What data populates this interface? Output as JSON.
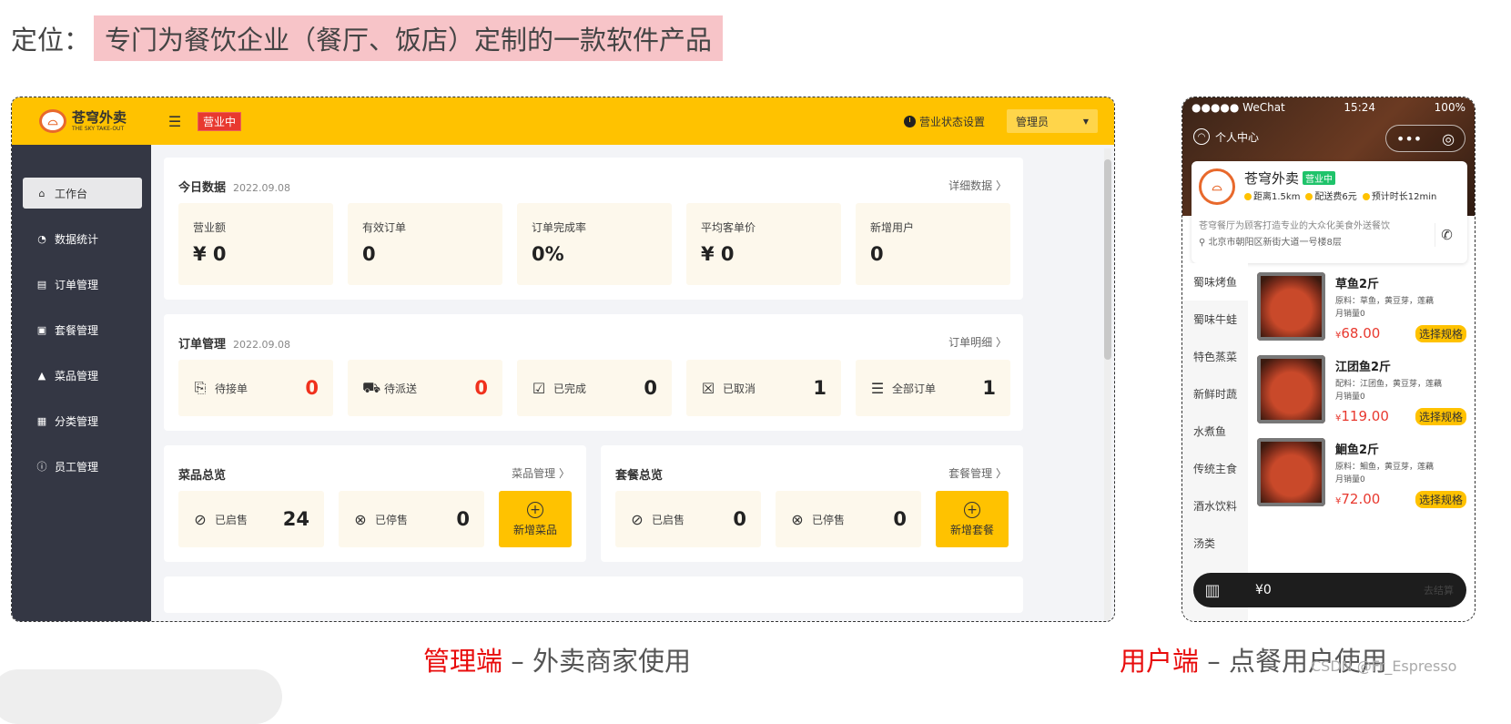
{
  "headline": {
    "prefix": "定位：",
    "highlight": "专门为餐饮企业（餐厅、饭店）定制的一款软件产品"
  },
  "admin": {
    "logo": {
      "name": "苍穹外卖",
      "sub": "THE SKY TAKE-OUT"
    },
    "status_badge": "营业中",
    "status_setting": "营业状态设置",
    "user_select": "管理员",
    "sidebar": [
      {
        "label": "工作台",
        "icon": "home-icon",
        "glyph": "⌂"
      },
      {
        "label": "数据统计",
        "icon": "chart-icon",
        "glyph": "◔"
      },
      {
        "label": "订单管理",
        "icon": "clipboard-icon",
        "glyph": "▤"
      },
      {
        "label": "套餐管理",
        "icon": "gift-icon",
        "glyph": "▣"
      },
      {
        "label": "菜品管理",
        "icon": "dish-icon",
        "glyph": "▲"
      },
      {
        "label": "分类管理",
        "icon": "grid-icon",
        "glyph": "▦"
      },
      {
        "label": "员工管理",
        "icon": "info-icon",
        "glyph": "ⓘ"
      }
    ],
    "today": {
      "title": "今日数据",
      "date": "2022.09.08",
      "link": "详细数据 〉",
      "stats": [
        {
          "label": "营业额",
          "value": "¥ 0"
        },
        {
          "label": "有效订单",
          "value": "0"
        },
        {
          "label": "订单完成率",
          "value": "0%"
        },
        {
          "label": "平均客单价",
          "value": "¥ 0"
        },
        {
          "label": "新增用户",
          "value": "0"
        }
      ]
    },
    "orders": {
      "title": "订单管理",
      "date": "2022.09.08",
      "link": "订单明细 〉",
      "stats": [
        {
          "label": "待接单",
          "value": "0",
          "highlight": true,
          "icon": "pending-order-icon",
          "glyph": "⎘"
        },
        {
          "label": "待派送",
          "value": "0",
          "highlight": true,
          "icon": "delivery-icon",
          "glyph": "⛟"
        },
        {
          "label": "已完成",
          "value": "0",
          "highlight": false,
          "icon": "completed-icon",
          "glyph": "☑"
        },
        {
          "label": "已取消",
          "value": "1",
          "highlight": false,
          "icon": "cancelled-icon",
          "glyph": "☒"
        },
        {
          "label": "全部订单",
          "value": "1",
          "highlight": false,
          "icon": "all-orders-icon",
          "glyph": "☰"
        }
      ]
    },
    "dishes": {
      "title": "菜品总览",
      "link": "菜品管理 〉",
      "on_label": "已启售",
      "on_value": "24",
      "off_label": "已停售",
      "off_value": "0",
      "add_label": "新增菜品"
    },
    "setmeals": {
      "title": "套餐总览",
      "link": "套餐管理 〉",
      "on_label": "已启售",
      "on_value": "0",
      "off_label": "已停售",
      "off_value": "0",
      "add_label": "新增套餐"
    }
  },
  "phone": {
    "carrier": "●●●●● WeChat",
    "time": "15:24",
    "battery": "100%",
    "user_center": "个人中心",
    "shop": {
      "name": "苍穹外卖",
      "status": "营业中",
      "distance": "距离1.5km",
      "delivery_fee": "配送费6元",
      "eta": "预计时长12min",
      "desc": "苍穹餐厅为顾客打造专业的大众化美食外送餐饮",
      "address": "北京市朝阳区新街大道一号楼8层"
    },
    "categories": [
      "蜀味烤鱼",
      "蜀味牛蛙",
      "特色蒸菜",
      "新鲜时蔬",
      "水煮鱼",
      "传统主食",
      "酒水饮料",
      "汤类"
    ],
    "dishes": [
      {
        "name": "草鱼2斤",
        "material": "原料：草鱼，黄豆芽，莲藕",
        "sales": "月销量0",
        "price": "68.00",
        "spec": "选择规格"
      },
      {
        "name": "江团鱼2斤",
        "material": "配料：江团鱼，黄豆芽，莲藕",
        "sales": "月销量0",
        "price": "119.00",
        "spec": "选择规格"
      },
      {
        "name": "鮰鱼2斤",
        "material": "原料：鮰鱼，黄豆芽，莲藕",
        "sales": "月销量0",
        "price": "72.00",
        "spec": "选择规格"
      }
    ],
    "price_symbol": "¥",
    "cart_total": "¥0",
    "checkout": "去结算"
  },
  "captions": {
    "admin_red": "管理端",
    "admin_rest": " – 外卖商家使用",
    "user_red": "用户端",
    "user_rest": " – 点餐用户使用"
  },
  "watermark": "CSDN @Fr_Espresso",
  "colors": {
    "brand": "#ffc200",
    "sidebar": "#343744",
    "danger": "#f0311d",
    "highlight_bg": "#f7c4c8"
  }
}
